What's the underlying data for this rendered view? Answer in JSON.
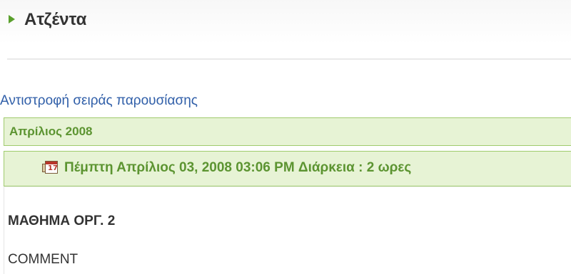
{
  "header": {
    "title": "Ατζέντα",
    "arrow_icon": "triangle-right-icon",
    "accent_color": "#5aa02c"
  },
  "controls": {
    "reverse_order_link": "Αντιστροφή σειράς παρουσίασης"
  },
  "agenda": {
    "month_label": "Απρίλιος 2008",
    "events": [
      {
        "icon": "calendar-icon",
        "icon_glyph": "17",
        "title": "Πέμπτη Απρίλιος 03, 2008 03:06 PM Διάρκεια : 2 ωρες",
        "subject": "ΜΑΘΗΜΑ ΟΡΓ. 2",
        "comment": "COMMENT"
      }
    ]
  },
  "colors": {
    "group_background": "#e7f3d5",
    "group_border": "#9fcb6d",
    "group_text": "#5c9431",
    "link": "#2f5ea8",
    "body_text": "#333333"
  }
}
